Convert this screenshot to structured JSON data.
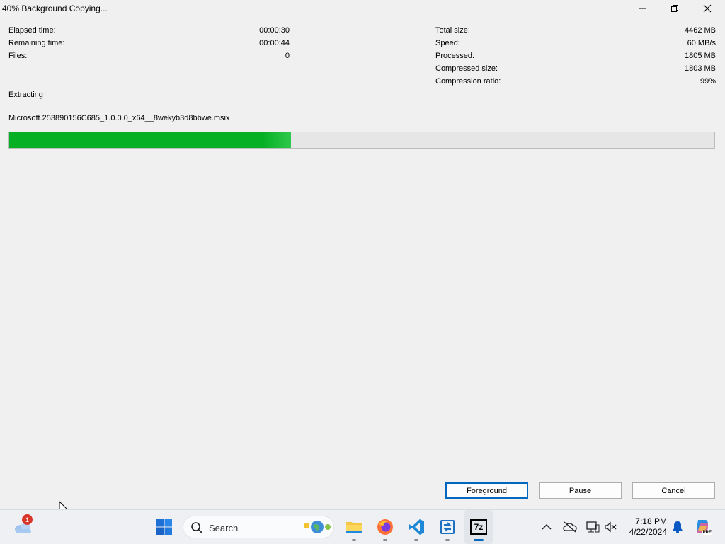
{
  "window": {
    "title": "40% Background Copying...",
    "minimize_icon": "minimize-icon",
    "maximize_icon": "restore-icon",
    "close_icon": "close-icon"
  },
  "stats_left": [
    {
      "label": "Elapsed time:",
      "value": "00:00:30"
    },
    {
      "label": "Remaining time:",
      "value": "00:00:44"
    },
    {
      "label": "Files:",
      "value": "0"
    }
  ],
  "stats_right": [
    {
      "label": "Total size:",
      "value": "4462 MB"
    },
    {
      "label": "Speed:",
      "value": "60 MB/s"
    },
    {
      "label": "Processed:",
      "value": "1805 MB"
    },
    {
      "label": "Compressed size:",
      "value": "1803 MB"
    },
    {
      "label": "Compression ratio:",
      "value": "99%"
    }
  ],
  "status": "Extracting",
  "current_file": "Microsoft.253890156C685_1.0.0.0_x64__8wekyb3d8bbwe.msix",
  "progress": {
    "percent": 40,
    "color": "#06b025"
  },
  "buttons": {
    "foreground": "Foreground",
    "pause": "Pause",
    "cancel": "Cancel"
  },
  "taskbar": {
    "weather_badge": "1",
    "search_placeholder": "Search",
    "apps": [
      "weather-icon",
      "start-icon",
      "search-icon",
      "file-explorer-icon",
      "firefox-icon",
      "vscode-icon",
      "remote-desktop-icon",
      "7zip-icon"
    ],
    "seven_zip_label": "7z",
    "tray": [
      "chevron-up-icon",
      "onedrive-off-icon",
      "network-icon",
      "volume-muted-icon"
    ],
    "time": "7:18 PM",
    "date": "4/22/2024",
    "copilot_label": "PRE"
  }
}
